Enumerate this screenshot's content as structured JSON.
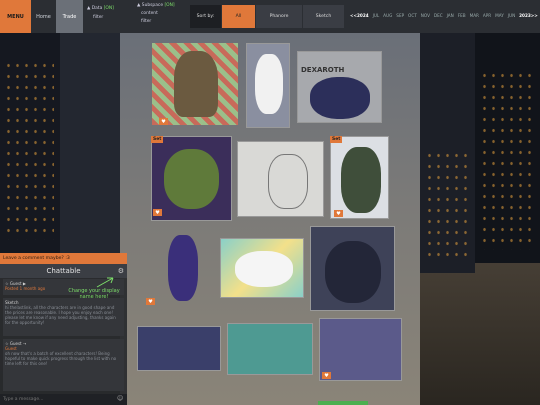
{
  "topbar": {
    "menu_label": "MENU",
    "nav": [
      {
        "label": "Home"
      },
      {
        "label": "Trade"
      }
    ],
    "filters": [
      {
        "name": "Data",
        "state": "[ON]",
        "sub": "filter"
      },
      {
        "name": "Subspace",
        "state": "[ON]",
        "sub1": "content",
        "sub2": "filter"
      }
    ],
    "sort": {
      "label": "Sort by:",
      "options": [
        "All",
        "Phanore",
        "Sketch"
      ],
      "selected": "All"
    },
    "years": {
      "start": "<<2024",
      "months": [
        "JUL",
        "AUG",
        "SEP",
        "OCT",
        "NOV",
        "DEC",
        "JAN",
        "FEB",
        "MAR",
        "APR",
        "MAY",
        "JUN"
      ],
      "end": "2023>>"
    }
  },
  "gallery": {
    "set_badge": "Set",
    "heart_icon": "heart-icon",
    "watermark": "DEXAROTH"
  },
  "chat": {
    "header": "Leave a comment maybe? :3",
    "title": "Chattable",
    "messages": [
      {
        "meta": "☆ Guest ▶",
        "name": "Guest",
        "text": "Posted 1 month ago"
      },
      {
        "meta": "",
        "name": "Sketch",
        "text": "hi thelastlink, all the characters are in good shape and the prices are reasonable. I hope you enjoy each one! please let me know if any need adjusting, thanks again for the opportunity!"
      },
      {
        "meta": "☆ Guest →",
        "name": "Guest",
        "text": "oh now that's a batch of excellent characters! Being hopeful to make quick progress through the list with no time left for this one!"
      }
    ],
    "hint": "Change your display name here!",
    "input_placeholder": "Type a message..."
  },
  "colors": {
    "accent": "#e0783a",
    "on": "#7ddf6a"
  }
}
